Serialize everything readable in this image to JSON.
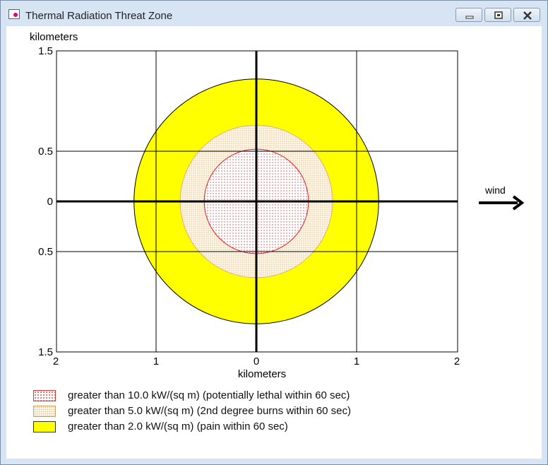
{
  "window": {
    "title": "Thermal Radiation Threat Zone",
    "buttons": [
      "minimize",
      "maximize",
      "close"
    ]
  },
  "chart_data": {
    "type": "area",
    "title": "",
    "ylabel": "kilometers",
    "xlabel": "kilometers",
    "xlim": [
      -2,
      2
    ],
    "ylim": [
      -1.5,
      1.5
    ],
    "grid": true,
    "x_ticks": [
      {
        "value": -2,
        "label": "2"
      },
      {
        "value": -1,
        "label": "1"
      },
      {
        "value": 0,
        "label": "0"
      },
      {
        "value": 1,
        "label": "1"
      },
      {
        "value": 2,
        "label": "2"
      }
    ],
    "y_ticks": [
      {
        "value": 1.5,
        "label": "1.5"
      },
      {
        "value": 0.5,
        "label": "0.5"
      },
      {
        "value": 0,
        "label": "0"
      },
      {
        "value": -0.5,
        "label": "0.5"
      },
      {
        "value": -1.5,
        "label": "1.5"
      }
    ],
    "zones": [
      {
        "name": "greater than 2.0 kW/(sq m) (pain within 60 sec)",
        "radius_km": 1.22,
        "color": "#ffff00",
        "pattern": "solid"
      },
      {
        "name": "greater than 5.0 kW/(sq m) (2nd degree burns within 60 sec)",
        "radius_km": 0.76,
        "color": "#f0c890",
        "pattern": "dots"
      },
      {
        "name": "greater than 10.0 kW/(sq m) (potentially lethal within 60 sec)",
        "radius_km": 0.52,
        "color": "#dd3333",
        "pattern": "dots"
      }
    ],
    "annotation": "wind",
    "wind_direction": "east"
  },
  "legend": [
    {
      "label": "greater than 10.0 kW/(sq m) (potentially lethal within 60 sec)",
      "swatch": "lethal"
    },
    {
      "label": "greater than 5.0 kW/(sq m) (2nd degree burns within 60 sec)",
      "swatch": "burns"
    },
    {
      "label": "greater than 2.0 kW/(sq m) (pain within 60 sec)",
      "swatch": "pain"
    }
  ],
  "wind_label": "wind"
}
